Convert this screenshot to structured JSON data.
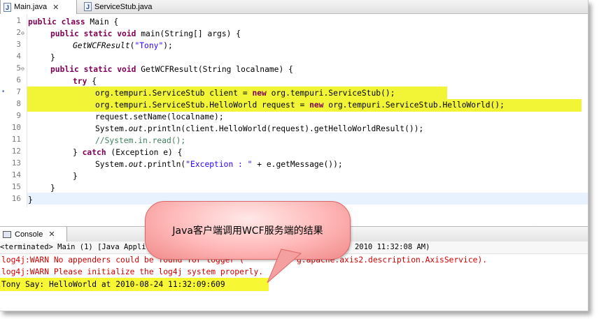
{
  "tabs": [
    {
      "label": "Main.java",
      "close": "✕"
    },
    {
      "label": "ServiceStub.java"
    }
  ],
  "editor": {
    "line_numbers": [
      "1",
      "2",
      "3",
      "4",
      "5",
      "6",
      "7",
      "8",
      "9",
      "10",
      "11",
      "12",
      "13",
      "14",
      "15",
      "16"
    ],
    "lines": {
      "l1_kw": "public class",
      "l1_rest": " Main {",
      "l2_kw": "public static void",
      "l2_rest": " main(String[] args) {",
      "l3_call": "GetWCFResult",
      "l3_open": "(",
      "l3_str": "\"Tony\"",
      "l3_close": ");",
      "l4": "}",
      "l5_kw": "public static void",
      "l5_rest": " GetWCFResult(String localname) {",
      "l6_kw": "try",
      "l6_rest": " {",
      "l7_a": "org.tempuri.ServiceStub client = ",
      "l7_kw": "new",
      "l7_b": " org.tempuri.ServiceStub();",
      "l8_a": "org.tempuri.ServiceStub.HelloWorld request = ",
      "l8_kw": "new",
      "l8_b": " org.tempuri.ServiceStub.HelloWorld();",
      "l9": "request.setName(localname);",
      "l10_a": "System.",
      "l10_out": "out",
      "l10_b": ".println(client.HelloWorld(request).getHelloWorldResult());",
      "l11": "//System.in.read();",
      "l12_a": "} ",
      "l12_kw": "catch",
      "l12_b": " (Exception e) {",
      "l13_a": "System.",
      "l13_out": "out",
      "l13_b": ".println(",
      "l13_str": "\"Exception : \"",
      "l13_c": " + e.getMessage());",
      "l14": "}",
      "l15": "}",
      "l16": "}"
    }
  },
  "console": {
    "tab_label": "Console",
    "tab_close": "✕",
    "terminated": "<terminated> Main (1) [Java Applica",
    "terminated_tail": "a, 2010 11:32:08 AM)",
    "warn1_a": "log4j:WARN No appenders could be found for logger (",
    "warn1_b": "g.apache.axis2.description.AxisService).",
    "warn2": "log4j:WARN Please initialize the log4j system properly.",
    "output": "Tony Say: HelloWorld at 2010-08-24 11:32:09:609"
  },
  "callout": {
    "text": "Java客户端调用WCF服务端的结果"
  },
  "colors": {
    "highlight": "#f2f535",
    "keyword": "#7f0055",
    "string": "#2a00ff",
    "warn": "#d40000",
    "bubble": "#ffb7b7"
  }
}
